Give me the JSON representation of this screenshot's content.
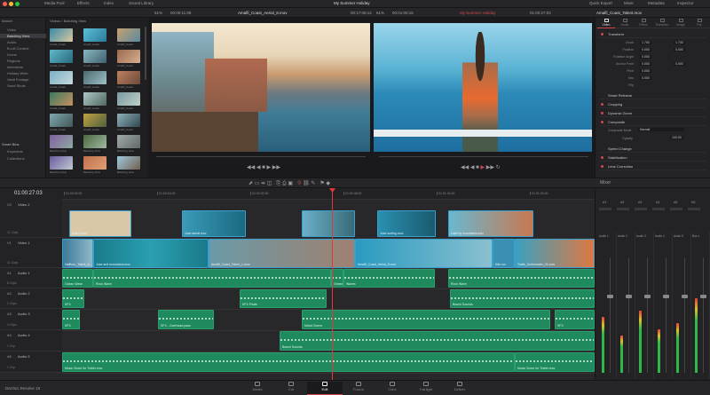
{
  "window": {
    "title": "My Summer Holiday",
    "app_name": "DaVinci Resolve 18"
  },
  "topbar": {
    "left": [
      "Media Pool",
      "Effects",
      "Index",
      "Sound Library"
    ],
    "right": [
      "Quick Export",
      "Mixer",
      "Metadata",
      "Inspector"
    ]
  },
  "source_viewer": {
    "zoom": "61%",
    "timecode": "00:00:11:08",
    "clip": "Amalfi_Coast_Aerial_8.mov"
  },
  "timeline_viewer": {
    "duration": "00:17:08:12",
    "zoom": "61%",
    "timecode": "00:01:00:15",
    "timeline_name": "My Summer Holiday",
    "playhead_tc": "01:00:27:03",
    "clip": "Amalfi_Coast_Talent.mov"
  },
  "media_pool": {
    "breadcrumb": "Videos › Batching View",
    "bins": [
      "Master",
      "Video",
      "Batching View",
      "Audio",
      "B-roll Content",
      "Drone",
      "Regions",
      "Interviews",
      "Holiday Wide",
      "Vault Footage",
      "Sand Shots"
    ],
    "selected_bin": "Batching View",
    "smart_bins_title": "Smart Bins",
    "smart_bins": [
      "Keywords",
      "Collections"
    ],
    "clips": [
      "Amalfi_Coast",
      "Amalfi_Coast",
      "Amalfi_Coast",
      "Amalfi_Coast",
      "Amalfi_Coast",
      "Amalfi_Coast",
      "Amalfi_Coast",
      "Amalfi_Coast",
      "Amalfi_Coast",
      "Amalfi_Coast",
      "Amalfi_Coast",
      "Amalfi_Coast",
      "Amalfi_Coast",
      "Amalfi_Coast",
      "Amalfi_Coast",
      "Batching View",
      "Batching View",
      "Batching View",
      "Batching View",
      "Batching View",
      "Batching View"
    ]
  },
  "inspector": {
    "tabs": [
      "Video",
      "Audio",
      "Effect",
      "Transition",
      "Image",
      "File"
    ],
    "sections": {
      "transform": "Transform",
      "smart_reframe": "Smart Reframe",
      "cropping": "Cropping",
      "dynamic_zoom": "Dynamic Zoom",
      "composite": "Composite",
      "speed_change": "Speed Change",
      "stabilization": "Stabilization",
      "lens_correction": "Lens Correction"
    },
    "params": [
      {
        "label": "Zoom",
        "x": "1.700",
        "y": "1.700"
      },
      {
        "label": "Position",
        "x": "0.000",
        "y": "0.000"
      },
      {
        "label": "Rotation Angle",
        "x": "0.000"
      },
      {
        "label": "Anchor Point",
        "x": "0.000",
        "y": "0.000"
      },
      {
        "label": "Pitch",
        "x": "0.000"
      },
      {
        "label": "Yaw",
        "x": "0.000"
      },
      {
        "label": "Flip",
        "x": ""
      }
    ],
    "composite_mode_label": "Composite Mode",
    "composite_mode": "Normal",
    "opacity_label": "Opacity",
    "opacity": "100.00"
  },
  "timeline": {
    "timecode": "01:00:27:03",
    "ruler": [
      "01:00:00:00",
      "01:00:16:00",
      "01:00:32:00",
      "01:00:48:00",
      "01:01:04:00",
      "01:01:20:00"
    ],
    "tracks": [
      {
        "id": "V2",
        "name": "Video 2",
        "sub": "11 Clips"
      },
      {
        "id": "V1",
        "name": "Video 1",
        "sub": "11 Clips"
      },
      {
        "id": "A1",
        "name": "Audio 1",
        "sub": "8 Clips"
      },
      {
        "id": "A2",
        "name": "Audio 2",
        "sub": "2 Clips"
      },
      {
        "id": "A3",
        "name": "Audio 3",
        "sub": "3 Clips"
      },
      {
        "id": "A4",
        "name": "Audio 4",
        "sub": "1 Clip"
      },
      {
        "id": "A5",
        "name": "Audio 5",
        "sub": "1 Clip"
      }
    ],
    "v2_clips": [
      "Solid Color",
      "Jose aerial.mov",
      "",
      "Jose surfing.mov",
      "Lake by mountains.mov"
    ],
    "v1_clips": [
      "Haffboo_Talent_A...",
      "Jose and mountains.mov",
      "Amalfi_Coast_Talent_1.mov",
      "Amalfi_Coast_Aerial_8.mov",
      "Kite sur",
      "Turtle_Underwater_01.mov"
    ],
    "a1_clips": [
      "Ocean Wave",
      "Rock Wave",
      "Waves",
      "Rock Wave",
      "Ocean Wave"
    ],
    "a2_clips": [
      "SFX",
      "SFX Pirate",
      "Beach Sounds"
    ],
    "a3_clips": [
      "SFX",
      "SFX - Overhead pass",
      "Mixed Scene",
      "SFX"
    ],
    "a4_clips": [
      "Beach Sounds"
    ],
    "a5_clips": [
      "Music Score for Trailer.mov",
      "Music Score for Trailer.mov"
    ]
  },
  "mixer": {
    "title": "Mixer",
    "channels": [
      "A1",
      "A2",
      "A3",
      "A4",
      "A5",
      "M1"
    ],
    "strips": [
      "Audio 1",
      "Audio 2",
      "Audio 3",
      "Audio 4",
      "Audio 5",
      "Bus 1"
    ],
    "levels": [
      0.45,
      0.3,
      0.5,
      0.35,
      0.4,
      0.6
    ]
  },
  "pages": {
    "items": [
      "Media",
      "Cut",
      "Edit",
      "Fusion",
      "Color",
      "Fairlight",
      "Deliver"
    ],
    "active": "Edit"
  },
  "colors": {
    "accent": "#d0484f",
    "video_clip": "#2a7fb0",
    "audio_clip": "#1f8a5e",
    "playhead": "#e03a3a"
  }
}
